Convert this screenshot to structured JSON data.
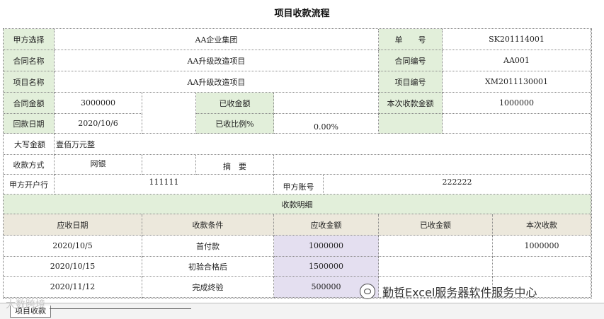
{
  "title": "项目收款流程",
  "form": {
    "party_a_label": "甲方选择",
    "party_a_value": "AA企业集团",
    "doc_no_label": "单　　号",
    "doc_no_value": "SK201114001",
    "contract_name_label": "合同名称",
    "contract_name_value": "AA升级改造项目",
    "contract_no_label": "合同编号",
    "contract_no_value": "AA001",
    "project_name_label": "项目名称",
    "project_name_value": "AA升级改造项目",
    "project_no_label": "项目编号",
    "project_no_value": "XM2011130001",
    "contract_amount_label": "合同金额",
    "contract_amount_value": "3000000",
    "received_amount_label": "已收金额",
    "received_amount_value": "",
    "this_amount_label": "本次收款金额",
    "this_amount_value": "1000000",
    "return_date_label": "回款日期",
    "return_date_value": "2020/10/6",
    "received_ratio_label": "已收比例%",
    "received_ratio_value": "0.00%",
    "capital_amount_label": "大写金额",
    "capital_amount_value": "壹佰万元整",
    "method_label": "收款方式",
    "method_value": "网银",
    "summary_label": "摘　要",
    "summary_value": "",
    "bank_label": "甲方开户行",
    "bank_value": "111111",
    "account_label": "甲方账号",
    "account_value": "222222"
  },
  "detail": {
    "section_title": "收款明细",
    "headers": [
      "应收日期",
      "收款条件",
      "应收金额",
      "已收金额",
      "本次收款"
    ],
    "rows": [
      [
        "2020/10/5",
        "首付款",
        "1000000",
        "",
        "1000000"
      ],
      [
        "2020/10/15",
        "初验合格后",
        "1500000",
        "",
        ""
      ],
      [
        "2020/11/12",
        "完成终验",
        "500000",
        "",
        ""
      ]
    ]
  },
  "sheet_tab": "项目收款",
  "watermarks": {
    "left": "大数跨境",
    "right": "勤哲Excel服务器软件服务中心"
  }
}
